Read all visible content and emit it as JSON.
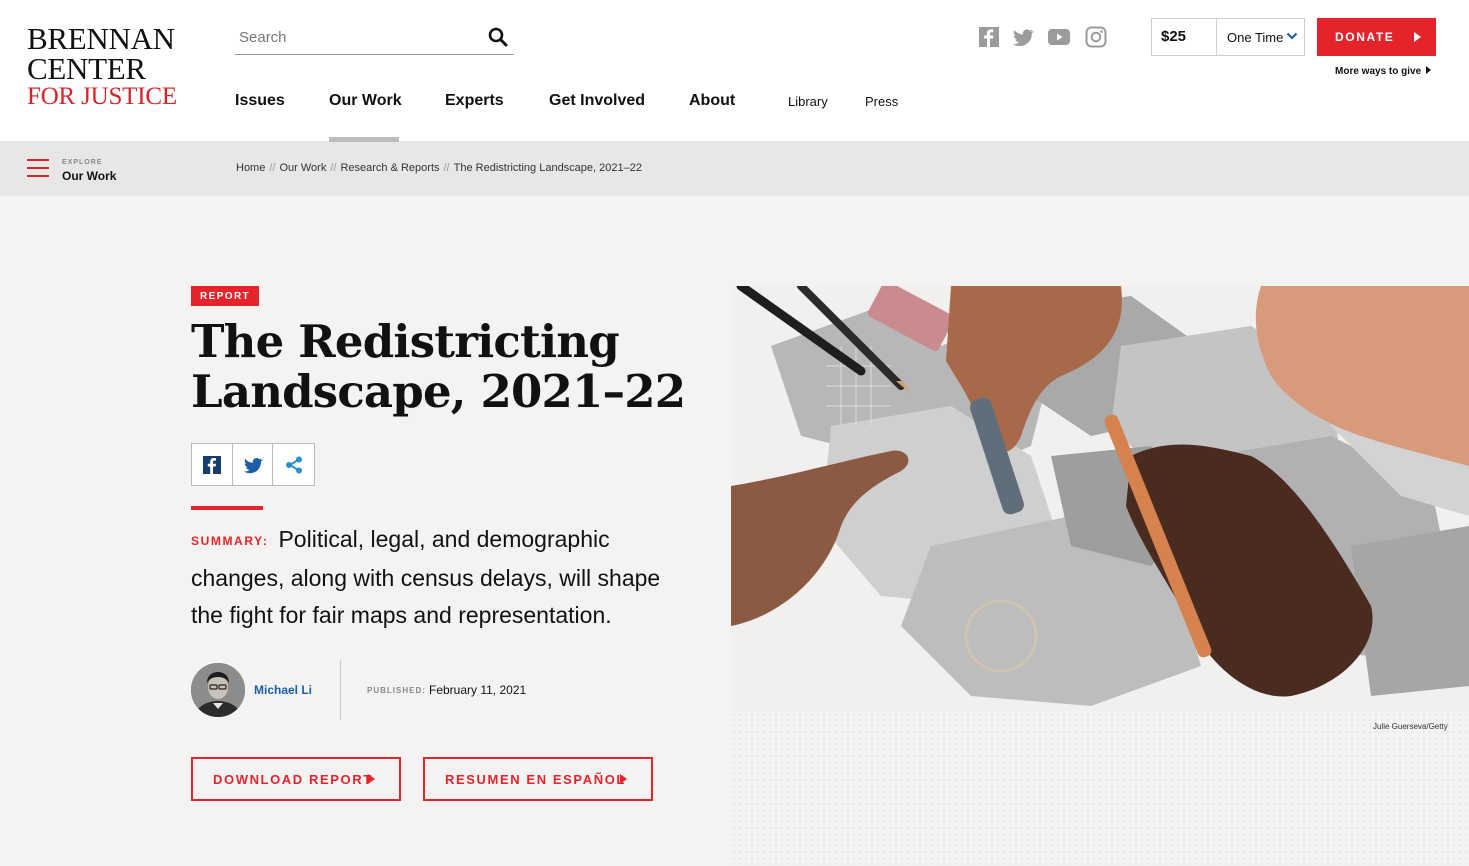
{
  "logo": {
    "line1": "BRENNAN",
    "line2": "CENTER",
    "line3": "FOR JUSTICE"
  },
  "search": {
    "placeholder": "Search",
    "icon": "search-icon"
  },
  "nav": {
    "items": [
      "Issues",
      "Our Work",
      "Experts",
      "Get Involved",
      "About"
    ],
    "secondary": [
      "Library",
      "Press"
    ],
    "active": "Our Work"
  },
  "social": [
    "facebook-icon",
    "twitter-icon",
    "youtube-icon",
    "instagram-icon"
  ],
  "donate": {
    "amount": "$25",
    "frequency": "One Time",
    "button": "DONATE",
    "more": "More ways to give"
  },
  "colors": {
    "accent": "#e5232b",
    "link": "#1b5fa8"
  },
  "explore": {
    "label": "EXPLORE",
    "value": "Our Work"
  },
  "breadcrumb": [
    "Home",
    "Our Work",
    "Research & Reports",
    "The Redistricting Landscape, 2021–22"
  ],
  "article": {
    "badge": "REPORT",
    "title": "The Redistricting Landscape, 2021–22",
    "summary_label": "SUMMARY:",
    "summary": "Political, legal, and demographic changes, along with census delays, will shape the fight for fair maps and representation.",
    "author": "Michael Li",
    "published_label": "PUBLISHED:",
    "published_date": "February 11, 2021",
    "download_label": "DOWNLOAD REPORT",
    "spanish_label": "RESUMEN EN ESPAÑOL",
    "image_credit": "Julie Guerseva/Getty"
  }
}
